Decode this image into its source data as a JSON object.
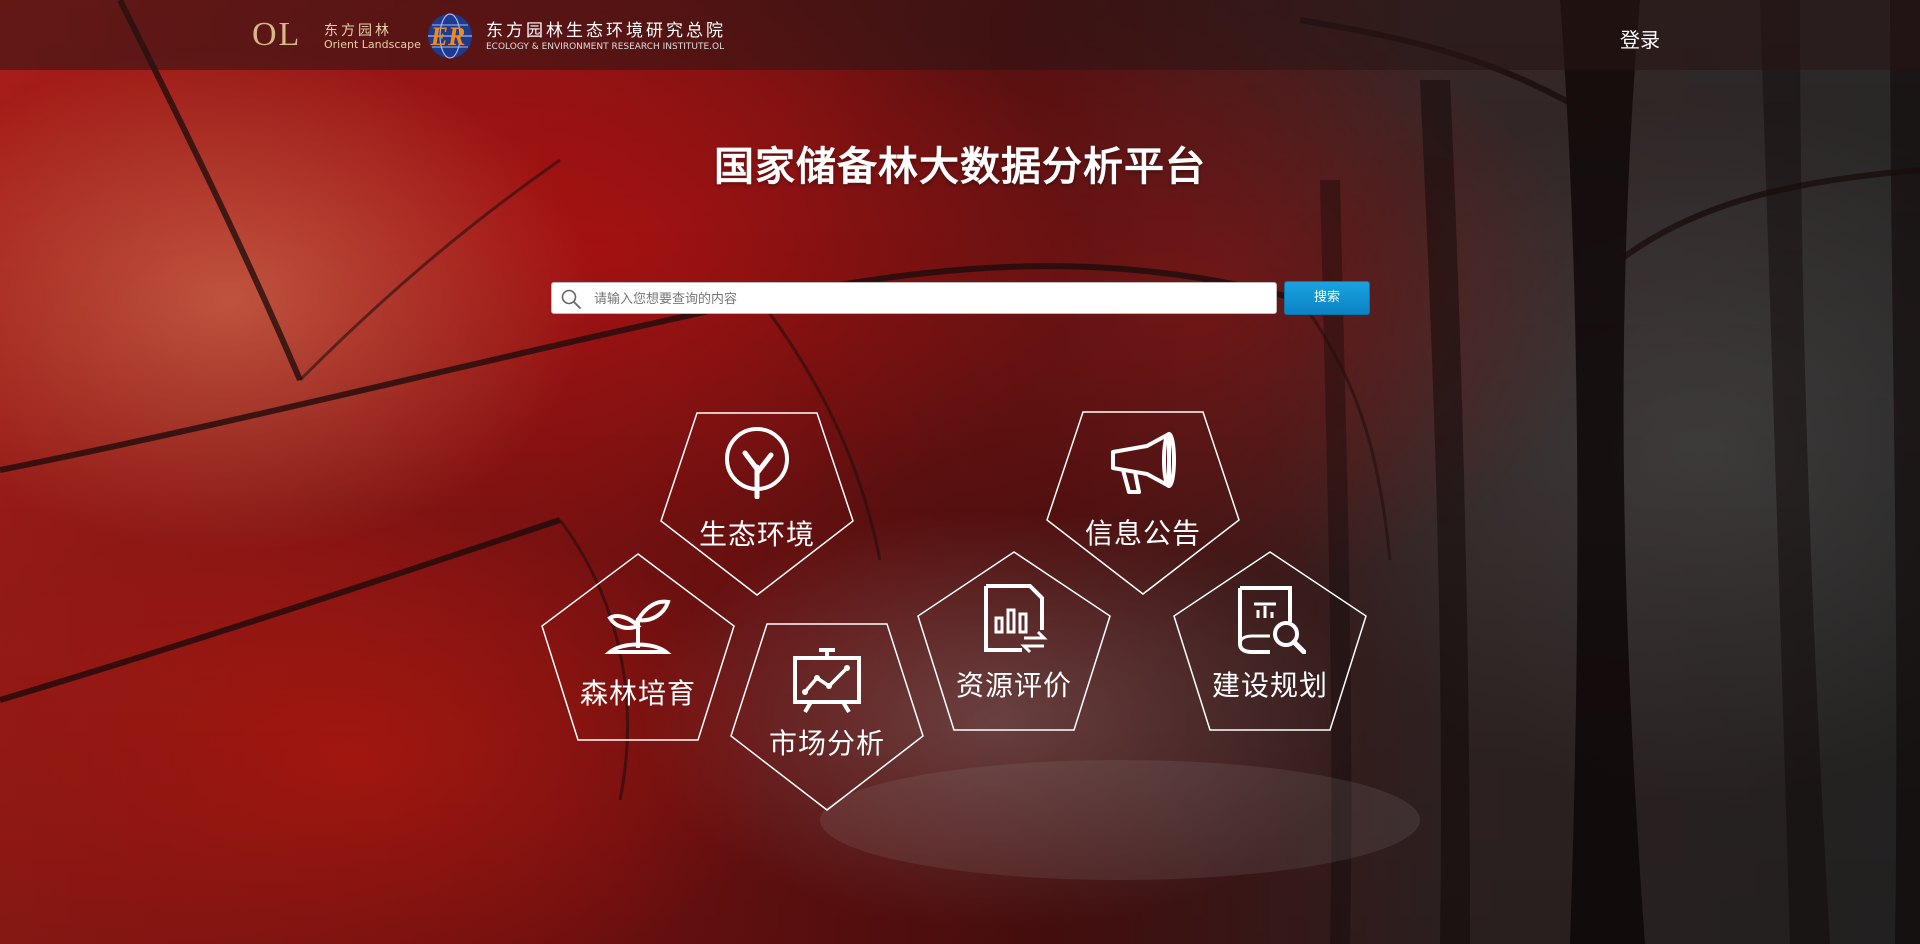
{
  "header": {
    "logo_ol": {
      "mark": "OL",
      "name_cn": "东方园林",
      "name_en": "Orient Landscape"
    },
    "logo_er": {
      "mark": "ER",
      "name_cn": "东方园林生态环境研究总院",
      "name_en": "ECOLOGY & ENVIRONMENT RESEARCH INSTITUTE.OL"
    },
    "login_label": "登录"
  },
  "main": {
    "title": "国家储备林大数据分析平台",
    "search": {
      "placeholder": "请输入您想要查询的内容",
      "value": "",
      "button_label": "搜索"
    },
    "tiles": [
      {
        "label": "生态环境",
        "icon": "tree-icon"
      },
      {
        "label": "信息公告",
        "icon": "megaphone-icon"
      },
      {
        "label": "森林培育",
        "icon": "sprout-icon"
      },
      {
        "label": "市场分析",
        "icon": "chart-board-icon"
      },
      {
        "label": "资源评价",
        "icon": "report-exchange-icon"
      },
      {
        "label": "建设规划",
        "icon": "book-search-icon"
      }
    ]
  },
  "colors": {
    "accent_button": "#0c83c4",
    "tile_stroke": "#ffffff",
    "ol_gold": "#d8b88a"
  }
}
